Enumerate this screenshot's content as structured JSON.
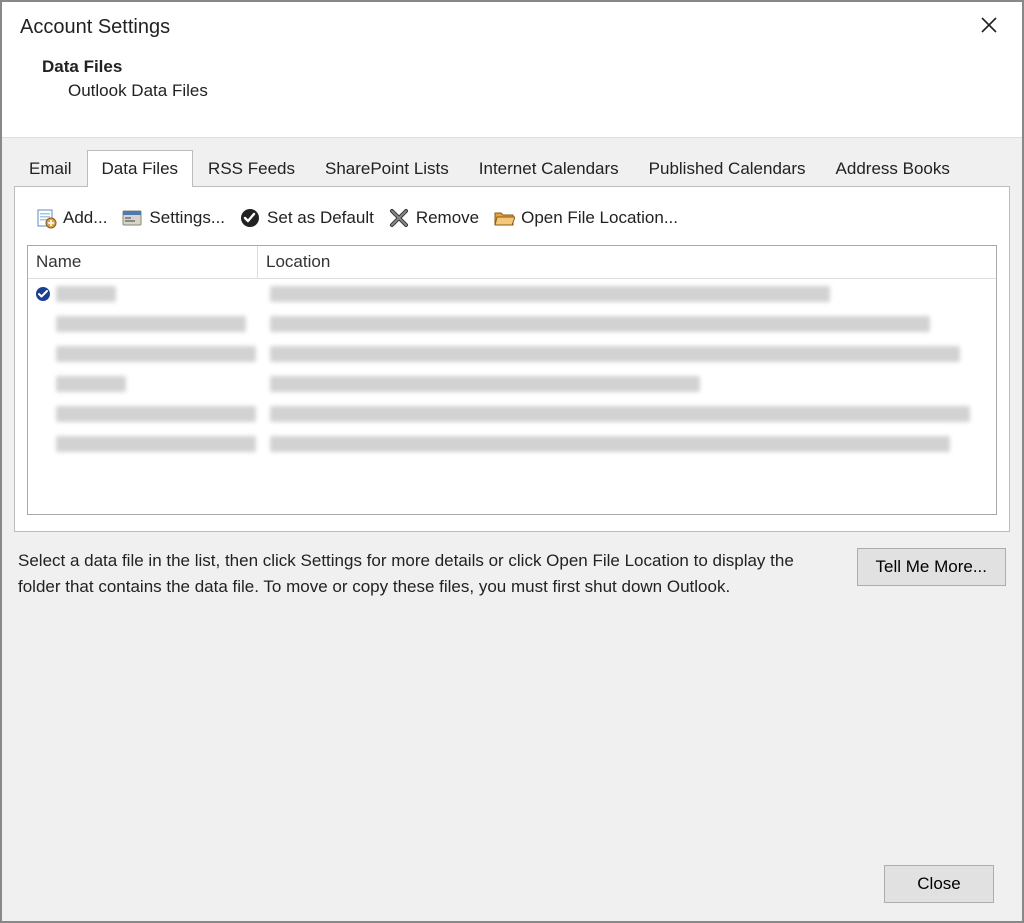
{
  "window_title": "Account Settings",
  "section": {
    "title": "Data Files",
    "description": "Outlook Data Files"
  },
  "tabs": [
    {
      "label": "Email",
      "active": false
    },
    {
      "label": "Data Files",
      "active": true
    },
    {
      "label": "RSS Feeds",
      "active": false
    },
    {
      "label": "SharePoint Lists",
      "active": false
    },
    {
      "label": "Internet Calendars",
      "active": false
    },
    {
      "label": "Published Calendars",
      "active": false
    },
    {
      "label": "Address Books",
      "active": false
    }
  ],
  "toolbar": {
    "add": "Add...",
    "settings": "Settings...",
    "set_default": "Set as Default",
    "remove": "Remove",
    "open_loc": "Open File Location..."
  },
  "columns": {
    "name": "Name",
    "location": "Location"
  },
  "rows": [
    {
      "default": true,
      "name_w": 60,
      "loc_w": 560
    },
    {
      "default": false,
      "name_w": 190,
      "loc_w": 660
    },
    {
      "default": false,
      "name_w": 200,
      "loc_w": 690
    },
    {
      "default": false,
      "name_w": 70,
      "loc_w": 430
    },
    {
      "default": false,
      "name_w": 200,
      "loc_w": 700
    },
    {
      "default": false,
      "name_w": 200,
      "loc_w": 680
    }
  ],
  "help_text": "Select a data file in the list, then click Settings for more details or click Open File Location to display the folder that contains the data file. To move or copy these files, you must first shut down Outlook.",
  "tell_me_more": "Tell Me More...",
  "close": "Close"
}
